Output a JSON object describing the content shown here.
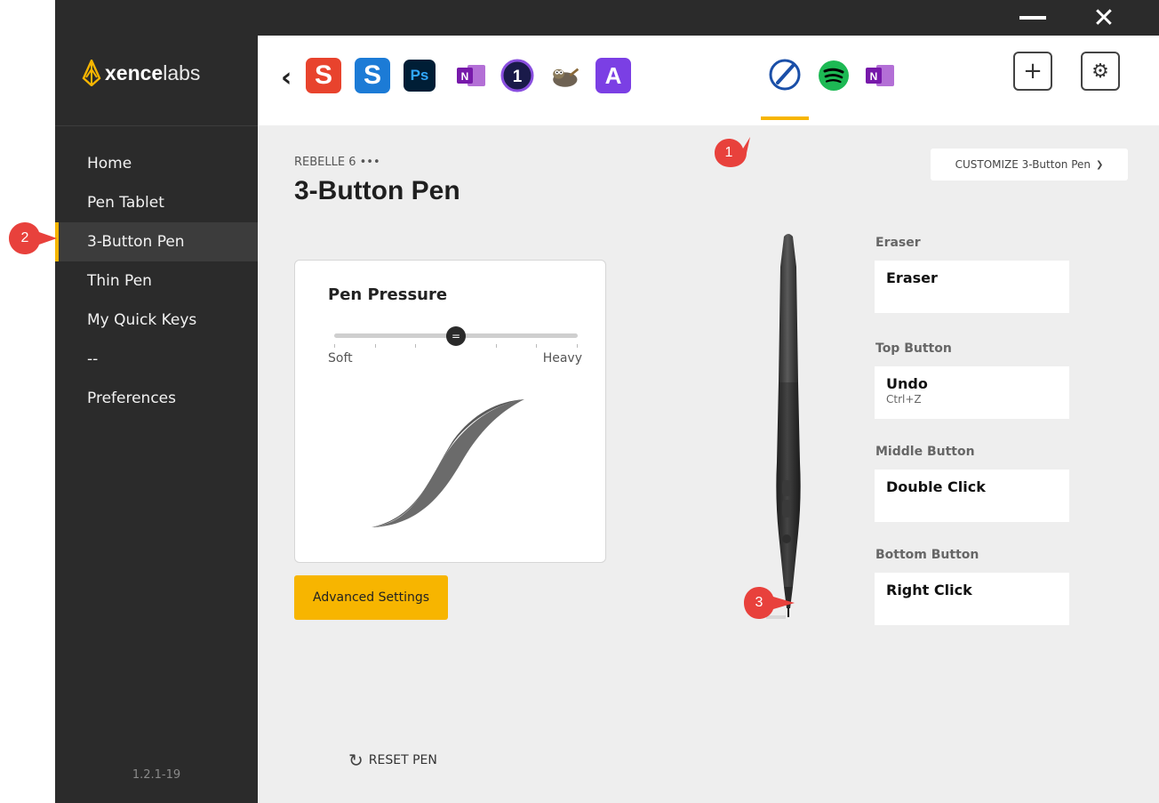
{
  "window": {
    "minimize_icon": "minimize-icon",
    "close_icon": "close-icon"
  },
  "sidebar": {
    "logo": {
      "bold": "xence",
      "light": "labs"
    },
    "items": [
      {
        "label": "Home",
        "active": false
      },
      {
        "label": "Pen Tablet",
        "active": false
      },
      {
        "label": "3-Button Pen",
        "active": true
      },
      {
        "label": "Thin Pen",
        "active": false
      },
      {
        "label": "My Quick Keys",
        "active": false
      },
      {
        "label": "--",
        "active": false
      },
      {
        "label": "Preferences",
        "active": false
      }
    ],
    "version": "1.2.1-19"
  },
  "appbar": {
    "back_icon": "chevron-left-icon",
    "apps": [
      {
        "name": "snagit-icon",
        "glyph": "S",
        "color": "#e8432d"
      },
      {
        "name": "snagit-editor-icon",
        "glyph": "S",
        "color": "#1c7bd6"
      },
      {
        "name": "photoshop-icon",
        "glyph": "Ps",
        "color": "#001e36"
      },
      {
        "name": "onenote-icon",
        "glyph": "N",
        "color": "#7719aa"
      },
      {
        "name": "affinity-icon",
        "glyph": "1",
        "color": "#1a1a4a"
      },
      {
        "name": "gimp-icon",
        "glyph": "",
        "color": "#8a7a5a"
      },
      {
        "name": "affinity-designer-icon",
        "glyph": "A",
        "color": "#7b3fe4"
      },
      {
        "name": "rebelle-icon",
        "glyph": "",
        "color": "#1a4fa8"
      },
      {
        "name": "spotify-icon",
        "glyph": "",
        "color": "#1db954"
      },
      {
        "name": "onenote-icon-2",
        "glyph": "N",
        "color": "#7719aa"
      }
    ],
    "selected_app_index": 7,
    "add_label": "+",
    "settings_icon": "gear-icon"
  },
  "main": {
    "profile_label": "REBELLE 6 •••",
    "title": "3-Button Pen",
    "customize_label": "CUSTOMIZE 3-Button Pen",
    "pressure": {
      "title": "Pen Pressure",
      "soft": "Soft",
      "heavy": "Heavy",
      "level": 0.5
    },
    "advanced_label": "Advanced Settings",
    "buttons": [
      {
        "section": "Eraser",
        "value": "Eraser",
        "sub": ""
      },
      {
        "section": "Top Button",
        "value": "Undo",
        "sub": "Ctrl+Z"
      },
      {
        "section": "Middle Button",
        "value": "Double Click",
        "sub": ""
      },
      {
        "section": "Bottom Button",
        "value": "Right Click",
        "sub": ""
      }
    ],
    "reset_label": "RESET PEN"
  },
  "annotations": [
    "1",
    "2",
    "3"
  ],
  "colors": {
    "accent": "#f7b500",
    "sidebar_bg": "#2b2b2b",
    "marker": "#e8413c"
  }
}
